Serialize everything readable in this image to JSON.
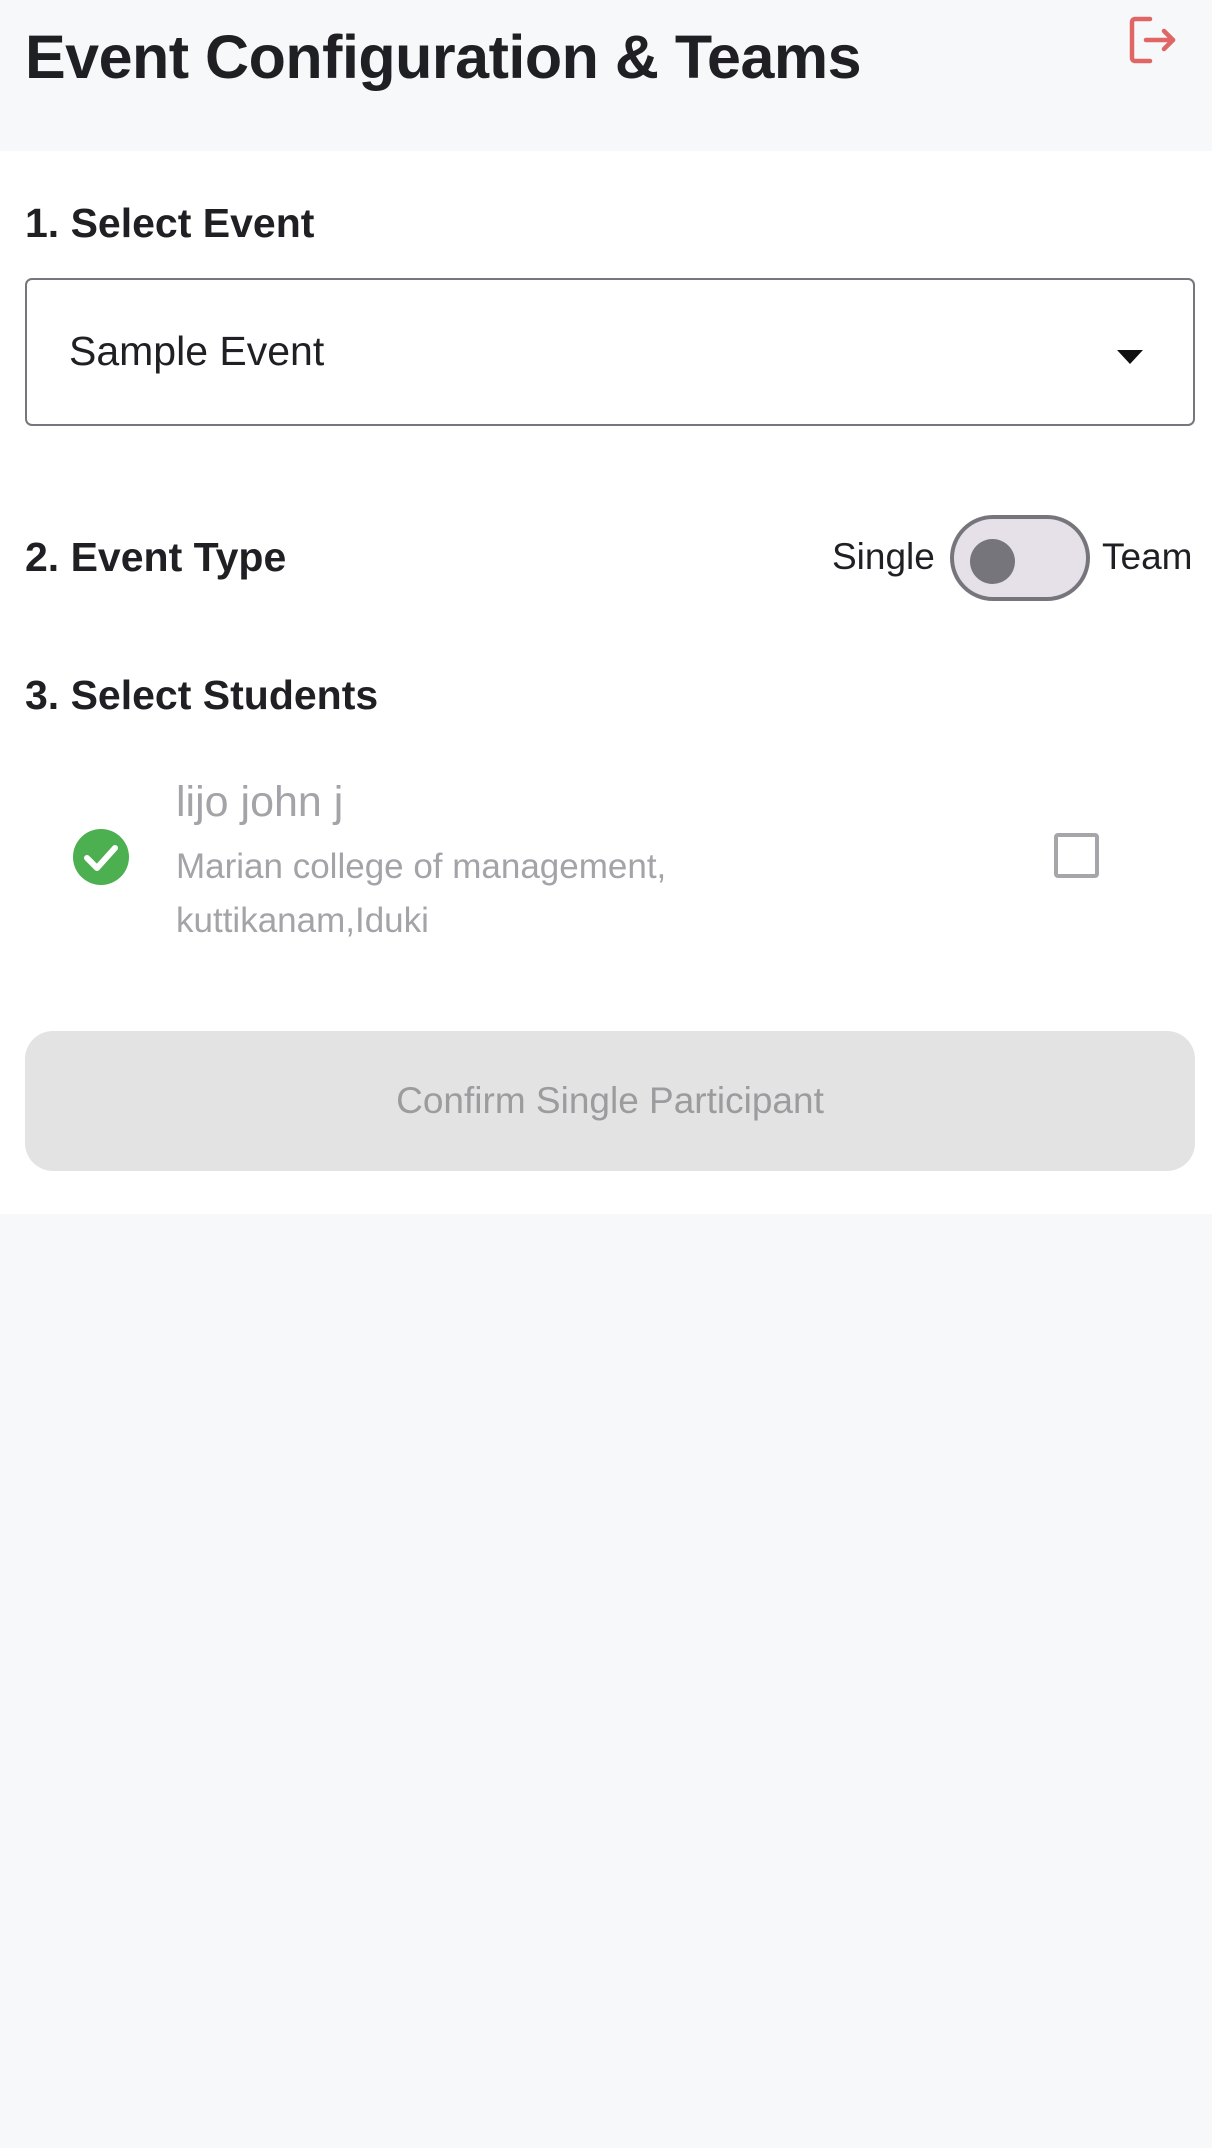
{
  "header": {
    "title": "Event Configuration & Teams",
    "logout_icon": "logout-icon",
    "logout_color": "#e06666"
  },
  "sections": {
    "select_event": "1. Select Event",
    "event_type": "2. Event Type",
    "select_students": "3. Select Students"
  },
  "event_select": {
    "value": "Sample Event",
    "caret_icon": "caret-down-icon"
  },
  "event_type_toggle": {
    "left_label": "Single",
    "right_label": "Team",
    "selected": "Single"
  },
  "students": [
    {
      "name": "lijo john j",
      "college": "Marian college of management, kuttikanam,Iduki",
      "status_icon": "check-circle-icon",
      "status_color": "#4caf50",
      "checked": false
    }
  ],
  "confirm_button": {
    "label": "Confirm Single Participant",
    "enabled": false
  }
}
